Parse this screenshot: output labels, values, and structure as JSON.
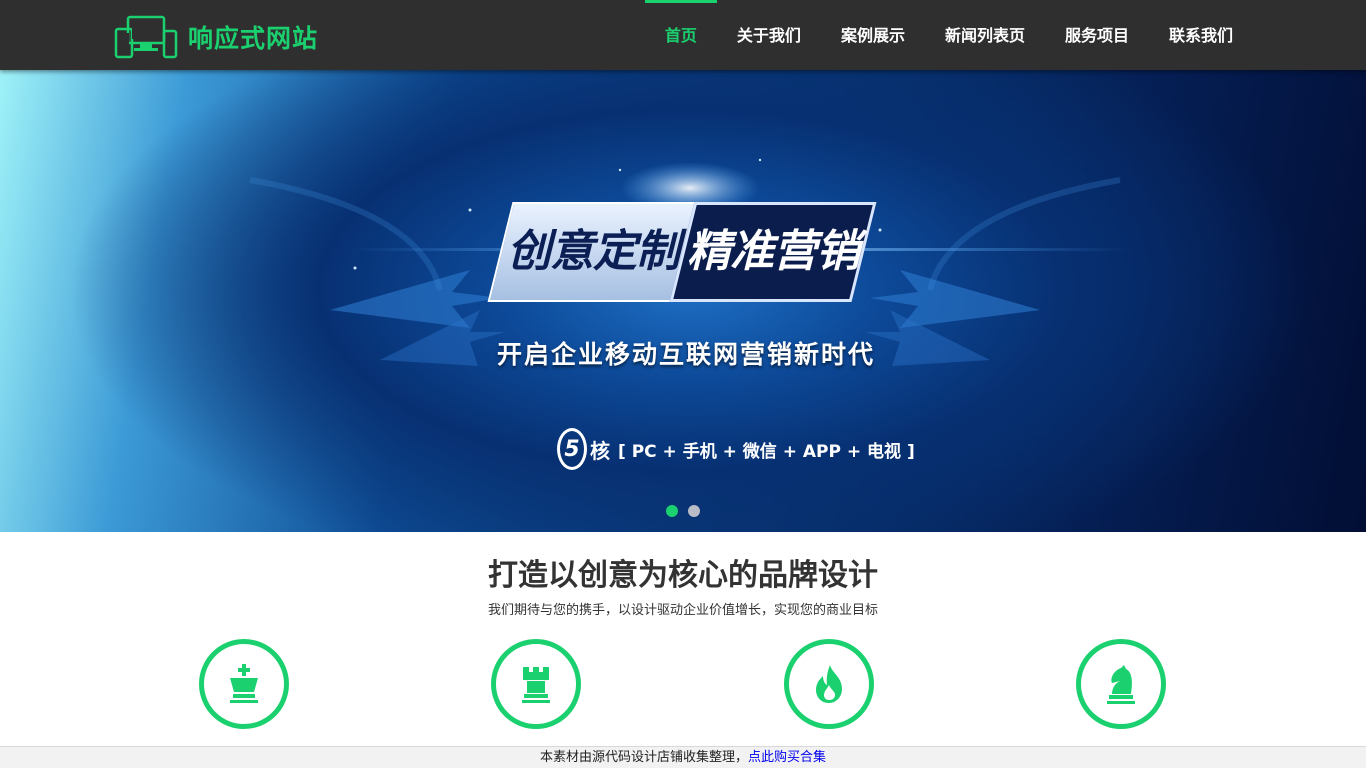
{
  "header": {
    "logo_text": "响应式网站",
    "nav": [
      {
        "label": "首页",
        "active": true
      },
      {
        "label": "关于我们"
      },
      {
        "label": "案例展示"
      },
      {
        "label": "新闻列表页"
      },
      {
        "label": "服务项目"
      },
      {
        "label": "联系我们"
      }
    ]
  },
  "banner": {
    "slogan_left": "创意定制",
    "slogan_right": "精准营销",
    "subtitle": "开启企业移动互联网营销新时代",
    "core_number": "5",
    "core_char": "核",
    "core_text": "[ PC + 手机 + 微信 + APP + 电视 ]",
    "slides": 2,
    "active_slide": 1
  },
  "intro": {
    "title": "打造以创意为核心的品牌设计",
    "subtitle": "我们期待与您的携手，以设计驱动企业价值增长，实现您的商业目标"
  },
  "features": [
    {
      "icon": "chess-king-icon"
    },
    {
      "icon": "chess-rook-icon"
    },
    {
      "icon": "flame-icon"
    },
    {
      "icon": "chess-knight-icon"
    }
  ],
  "notice": {
    "text": "本素材由源代码设计店铺收集整理，",
    "link": "点此购买合集"
  },
  "colors": {
    "accent": "#1bd06f",
    "header_bg": "#2f2f2f"
  }
}
